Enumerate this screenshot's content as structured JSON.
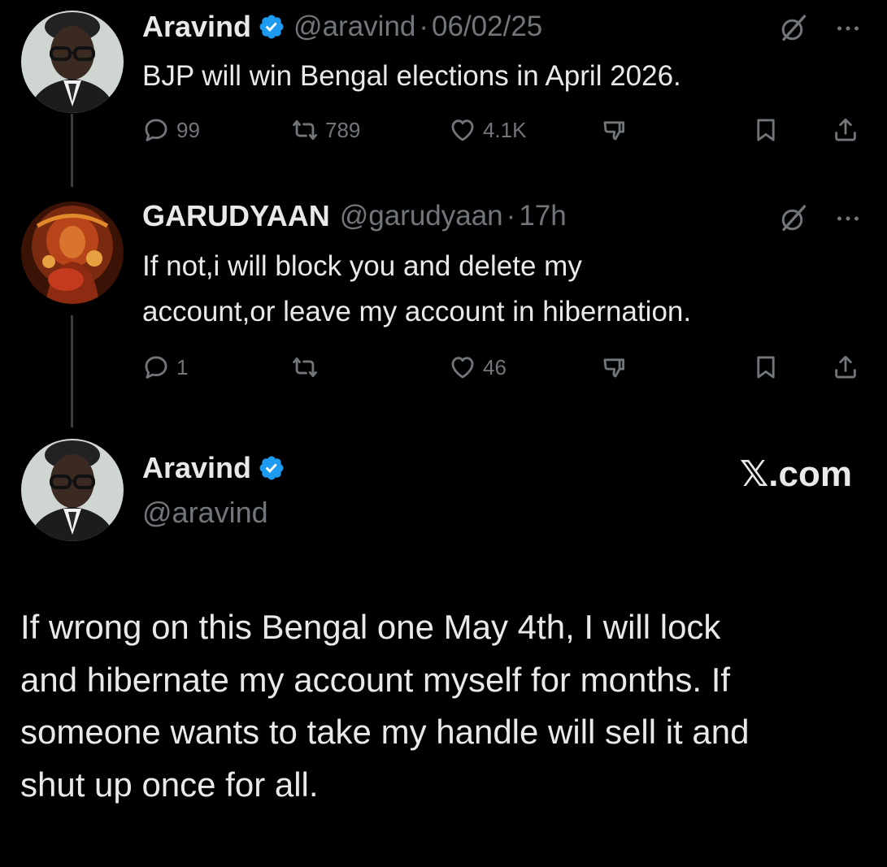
{
  "tweets": [
    {
      "name": "Aravind",
      "handle": "@aravind",
      "separator": "·",
      "time": "06/02/25",
      "text": "BJP will win Bengal elections in April 2026.",
      "metrics": {
        "replies": "99",
        "reposts": "789",
        "likes": "4.1K"
      }
    },
    {
      "name": "GARUDYAAN",
      "handle": "@garudyaan",
      "separator": "·",
      "time": "17h",
      "text_lines": [
        "If not,i will block you and delete my",
        "account,or leave my account in hibernation."
      ],
      "metrics": {
        "replies": "1",
        "reposts": "",
        "likes": "46"
      }
    }
  ],
  "quote": {
    "name": "Aravind",
    "handle": "@aravind",
    "brand": "𝕏.com",
    "text_lines": [
      "If wrong on this Bengal one May 4th, I will lock",
      "and hibernate my account myself for months. If",
      "someone wants to take my handle will sell it and",
      "shut up once for all."
    ]
  },
  "icons": {
    "verified": "verified-badge-icon",
    "grok": "grok-icon",
    "more": "more-dots-icon",
    "reply": "reply-icon",
    "repost": "repost-icon",
    "like": "heart-icon",
    "downvote": "downvote-icon",
    "bookmark": "bookmark-icon",
    "share": "share-icon"
  },
  "colors": {
    "background": "#000000",
    "text": "#e7e9ea",
    "muted": "#71767b",
    "verified": "#1d9bf0"
  }
}
